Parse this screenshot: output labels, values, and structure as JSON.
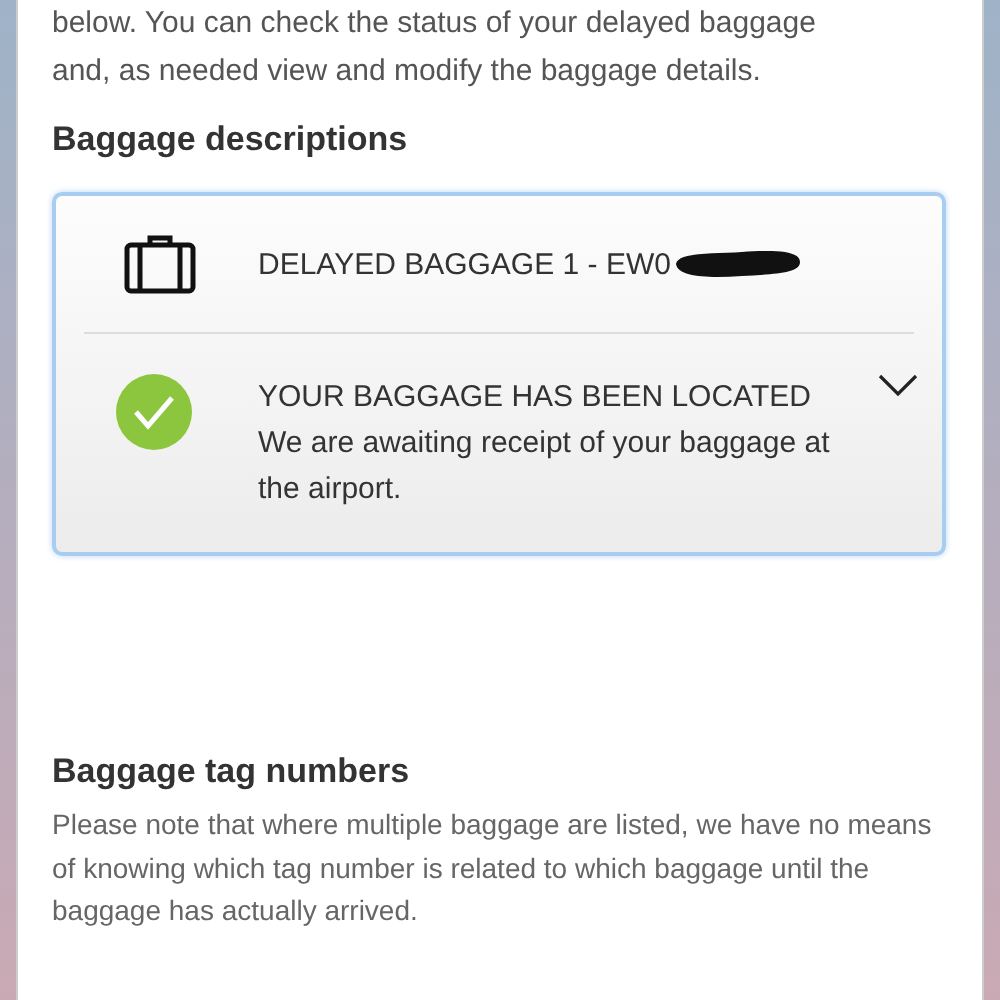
{
  "intro_lines": [
    "below. You can check the status of your delayed baggage",
    "and, as needed view and modify the baggage details."
  ],
  "descriptions": {
    "heading": "Baggage descriptions",
    "baggage": {
      "label": "DELAYED BAGGAGE 1 - EW0",
      "redacted": true
    },
    "status": {
      "kind": "located",
      "title": "YOUR BAGGAGE HAS BEEN LOCATED",
      "text": "We are awaiting receipt of your baggage at the airport.",
      "expanded": false
    }
  },
  "tags": {
    "heading": "Baggage tag numbers",
    "text": "Please note that where multiple baggage are listed, we have no means of knowing which tag number is related to which baggage until the baggage has actually arrived."
  }
}
